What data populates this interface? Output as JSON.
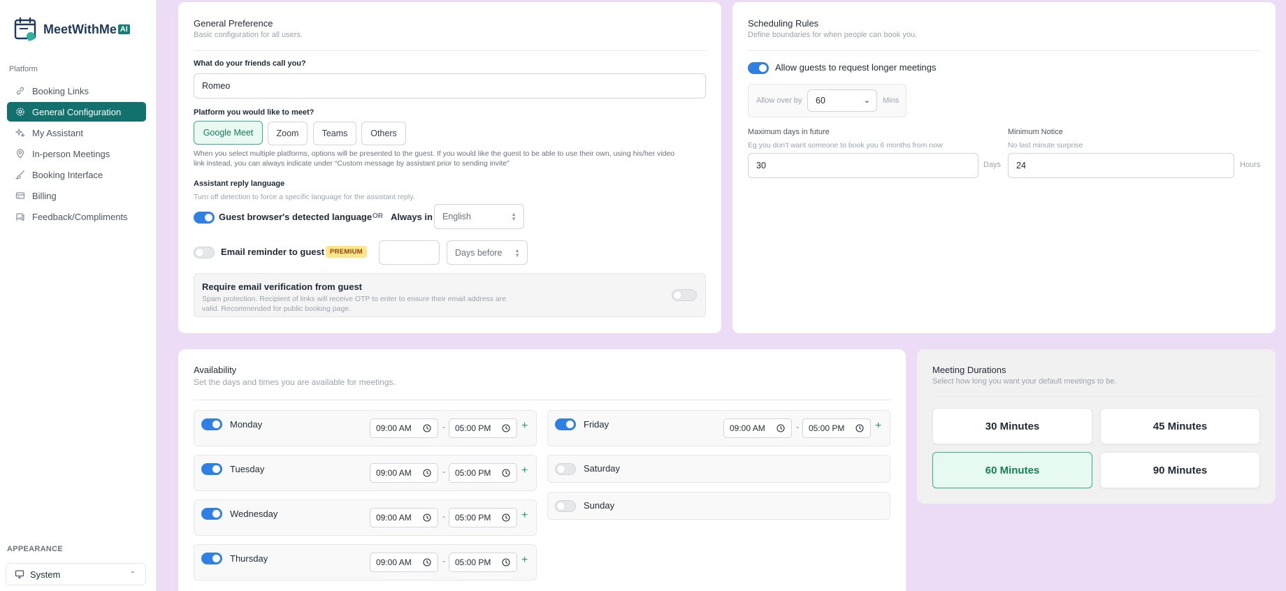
{
  "app": {
    "name": "MeetWithMe",
    "badge": "AI"
  },
  "sidebar": {
    "section": "Platform",
    "items": [
      {
        "label": "Booking Links",
        "icon": "link-icon"
      },
      {
        "label": "General Configuration",
        "icon": "gear-icon",
        "active": true
      },
      {
        "label": "My Assistant",
        "icon": "sparkle-icon"
      },
      {
        "label": "In-person Meetings",
        "icon": "map-pin-icon"
      },
      {
        "label": "Booking Interface",
        "icon": "brush-icon"
      },
      {
        "label": "Billing",
        "icon": "credit-card-icon"
      },
      {
        "label": "Feedback/Compliments",
        "icon": "chat-icon"
      }
    ],
    "appearance_label": "APPEARANCE",
    "appearance_value": "System"
  },
  "general": {
    "title": "General Preference",
    "subtitle": "Basic configuration for all users.",
    "name_label": "What do your friends call you?",
    "name_value": "Romeo",
    "platform_label": "Platform you would like to meet?",
    "platforms": [
      "Google Meet",
      "Zoom",
      "Teams",
      "Others"
    ],
    "platform_selected": "Google Meet",
    "platform_hint_1": "When you select multiple platforms, options will be presented to the guest. If you would like the guest to be able to use their own, using his/her video",
    "platform_hint_2": "link instead, you can always indicate under “Custom message by assistant prior to sending invite”",
    "lang_label": "Assistant reply language",
    "lang_hint": "Turn off detection to force a specific language for the assistant reply.",
    "lang_detect_label": "Guest browser's detected language",
    "lang_or": "OR",
    "lang_always": "Always in",
    "lang_value": "English",
    "reminder_label": "Email reminder to guest",
    "reminder_badge": "PREMIUM",
    "reminder_value": "",
    "reminder_unit": "Days before",
    "verify_title": "Require email verification from guest",
    "verify_hint_1": "Spam protection. Recipient of links will receive OTP to enter to ensure their email address are",
    "verify_hint_2": "valid. Recommended for public booking page."
  },
  "rules": {
    "title": "Scheduling Rules",
    "subtitle": "Define boundaries for when people can book you.",
    "longer_label": "Allow guests to request longer meetings",
    "allow_over_label": "Allow over by",
    "allow_over_value": "60",
    "allow_over_unit": "Mins",
    "max_days_label": "Maximum days in future",
    "max_days_hint": "Eg you don't want someone to book you 6 months from now",
    "max_days_value": "30",
    "max_days_unit": "Days",
    "notice_label": "Minimum Notice",
    "notice_hint": "No last minute surprise",
    "notice_value": "24",
    "notice_unit": "Hours"
  },
  "availability": {
    "title": "Availability",
    "subtitle": "Set the days and times you are available for meetings.",
    "dash": "-",
    "plus": "+",
    "days": [
      {
        "name": "Monday",
        "on": true,
        "start": "09:00 AM",
        "end": "05:00 PM"
      },
      {
        "name": "Tuesday",
        "on": true,
        "start": "09:00 AM",
        "end": "05:00 PM"
      },
      {
        "name": "Wednesday",
        "on": true,
        "start": "09:00 AM",
        "end": "05:00 PM"
      },
      {
        "name": "Thursday",
        "on": true,
        "start": "09:00 AM",
        "end": "05:00 PM"
      },
      {
        "name": "Friday",
        "on": true,
        "start": "09:00 AM",
        "end": "05:00 PM"
      },
      {
        "name": "Saturday",
        "on": false
      },
      {
        "name": "Sunday",
        "on": false
      }
    ]
  },
  "durations": {
    "title": "Meeting Durations",
    "subtitle": "Select how long you want your default meetings to be.",
    "options": [
      "30 Minutes",
      "45 Minutes",
      "60 Minutes",
      "90 Minutes"
    ],
    "selected": "60 Minutes"
  },
  "colors": {
    "brand": "#13716d",
    "toggle_on": "#2f80e4",
    "accent_green": "#34b08e"
  }
}
